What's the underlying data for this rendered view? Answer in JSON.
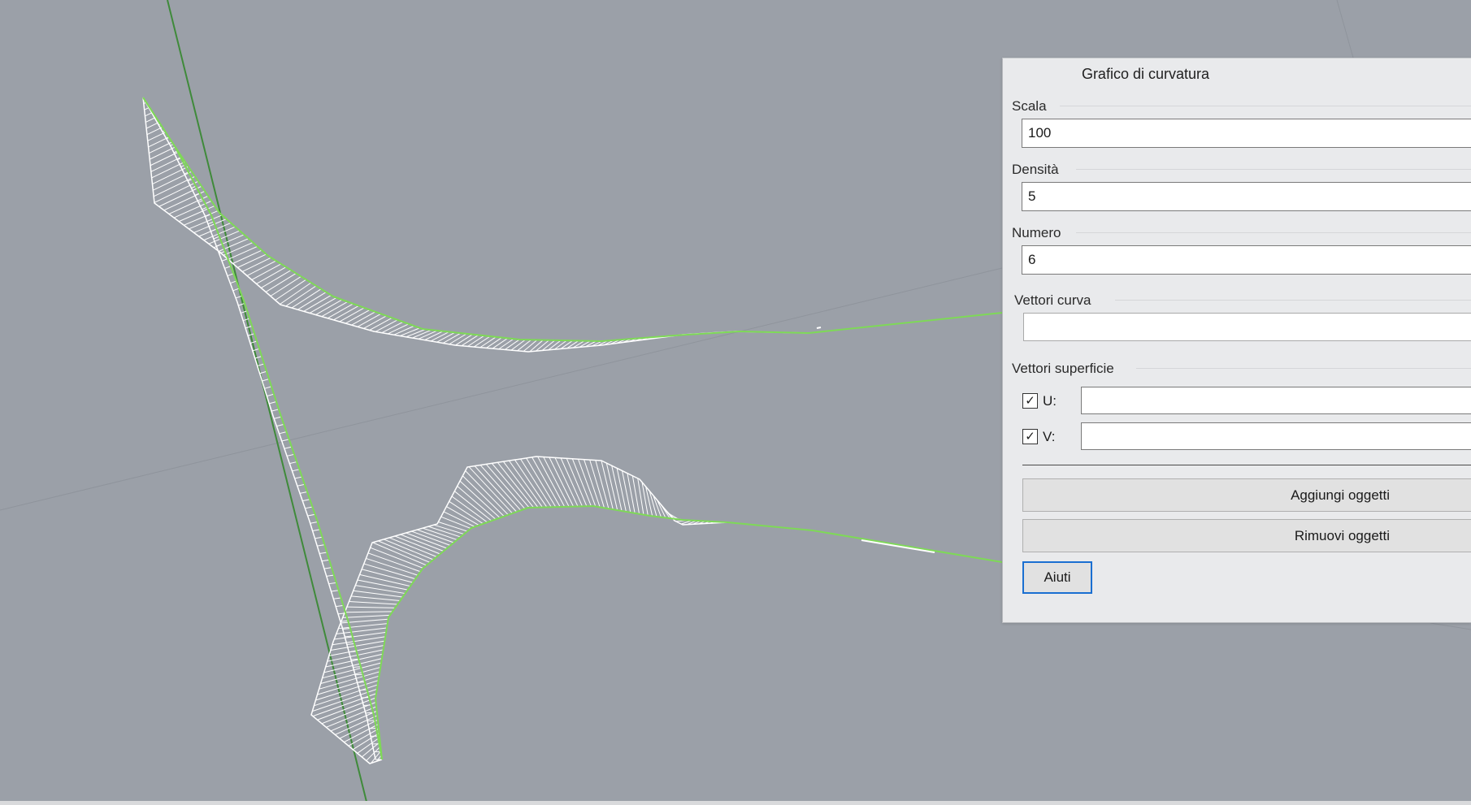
{
  "dialog": {
    "title": "Grafico di curvatura",
    "scala": {
      "label": "Scala",
      "value": "100"
    },
    "densita": {
      "label": "Densità",
      "value": "5"
    },
    "numero": {
      "label": "Numero",
      "value": "6"
    },
    "vettori_curva": {
      "label": "Vettori curva",
      "value": ""
    },
    "vettori_superficie": {
      "label": "Vettori superficie",
      "u": {
        "label": "U:",
        "checked": true
      },
      "v": {
        "label": "V:",
        "checked": true
      }
    },
    "buttons": {
      "add": "Aggiungi oggetti",
      "remove": "Rimuovi oggetti",
      "help": "Aiuti"
    }
  },
  "viewport": {
    "colors": {
      "background": "#9ba0a8",
      "curve": "#7ed957",
      "comb": "#ffffff",
      "axis_line": "#3f8a3a"
    }
  }
}
